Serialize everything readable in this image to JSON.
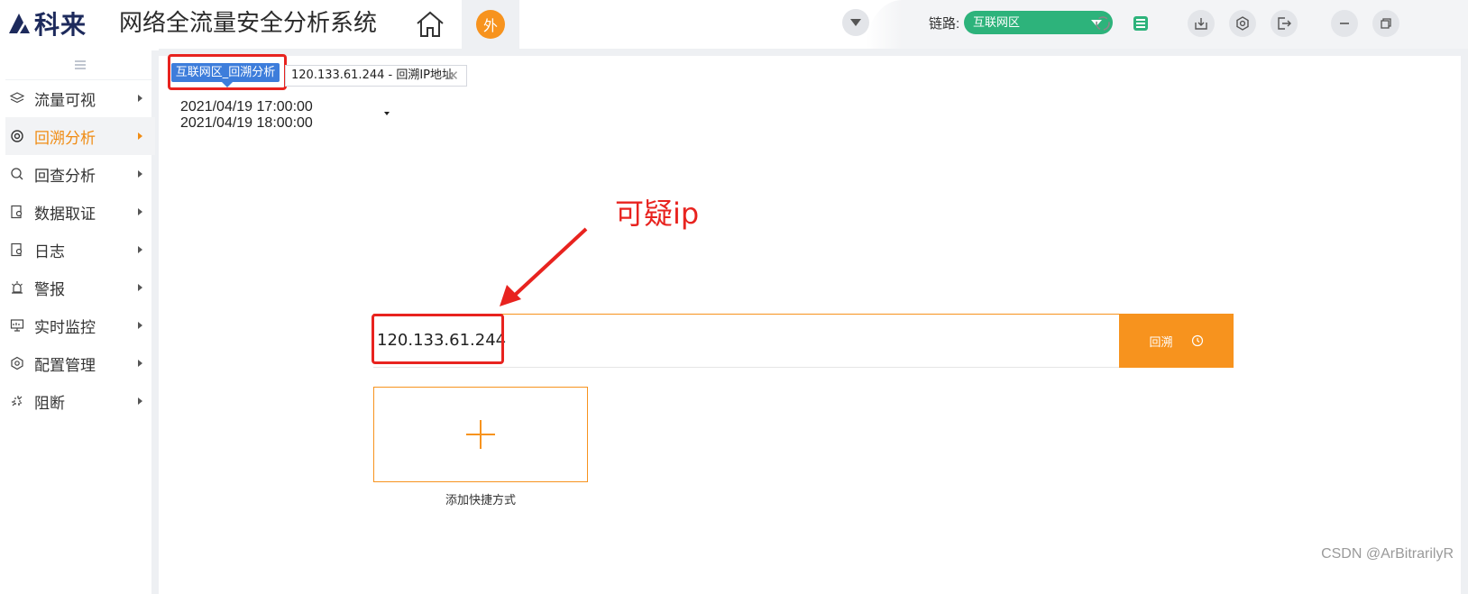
{
  "app": {
    "logo_text": "科来",
    "title": "网络全流量安全分析系统",
    "ext_badge": "外"
  },
  "header": {
    "link_label": "链路:",
    "link_value": "互联网区",
    "icons": [
      "chevron-down-icon",
      "refresh-icon",
      "stats-icon",
      "download-icon",
      "settings-icon",
      "logout-icon",
      "minimize-icon",
      "restore-icon"
    ]
  },
  "sidebar": {
    "items": [
      {
        "label": "流量可视",
        "icon": "layers-icon"
      },
      {
        "label": "回溯分析",
        "icon": "backtrack-icon",
        "active": true
      },
      {
        "label": "回查分析",
        "icon": "search-icon"
      },
      {
        "label": "数据取证",
        "icon": "evidence-icon"
      },
      {
        "label": "日志",
        "icon": "log-icon"
      },
      {
        "label": "警报",
        "icon": "alarm-icon"
      },
      {
        "label": "实时监控",
        "icon": "monitor-icon"
      },
      {
        "label": "配置管理",
        "icon": "config-icon"
      },
      {
        "label": "阻断",
        "icon": "block-icon"
      }
    ]
  },
  "tabs": {
    "active_label": "互联网区_回溯分析",
    "ip_tab_label": "120.133.61.244 - 回溯IP地址",
    "close_glyph": "✕"
  },
  "time_range": {
    "start": "2021/04/19 17:00:00",
    "end": "2021/04/19 18:00:00"
  },
  "annotation": {
    "text": "可疑ip"
  },
  "search": {
    "value": "120.133.61.244",
    "button_label": "回溯"
  },
  "shortcut": {
    "label": "添加快捷方式"
  },
  "watermark": "CSDN @ArBitrarilyR",
  "colors": {
    "accent": "#f7931e",
    "active_text": "#f08c14",
    "tab_blue": "#3d7ddb",
    "link_green": "#2db37b",
    "annotation_red": "#e8231f"
  }
}
